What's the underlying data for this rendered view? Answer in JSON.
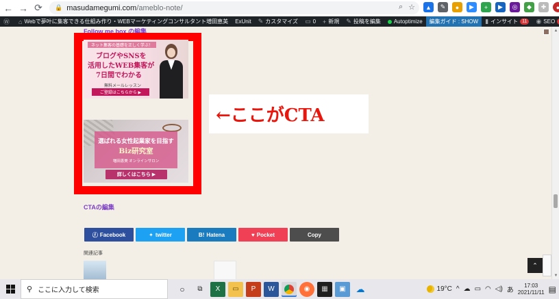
{
  "browser": {
    "url_host": "masudamegumi.com",
    "url_path": "/ameblo-note/"
  },
  "adminbar": {
    "site_name": "Webで夢叶に集客できる仕組み作り・WEBマーケティングコンサルタント増田恵美",
    "exunit": "ExUnit",
    "customize": "カスタマイズ",
    "comments": "0",
    "new": "新規",
    "edit_post": "投稿を編集",
    "autoptimize": "Autoptimize",
    "edit_guide": "編集ガイド : SHOW",
    "insight": "インサイト",
    "insight_badge": "11",
    "seo": "SEO",
    "seo_badge": "4"
  },
  "content": {
    "follow_link": "Follow me box の編集",
    "banner1": {
      "ribbon": "ネット集客の基礎を正しく学ぶ！",
      "line1": "ブログやSNSを",
      "line2": "活用したWEB集客が",
      "line3": "7日間でわかる",
      "sub": "無料メールレッスン",
      "button": "ご登録はこちらから ▶"
    },
    "banner2": {
      "line1": "選ばれる女性起業家を目指す",
      "line2": "Biz研究室",
      "line3": "増田恵美 オンラインサロン",
      "button": "詳しくはこちら ▶"
    },
    "annotation": "←ここがCTA",
    "cta_edit": "CTAの編集",
    "share": {
      "facebook": "Facebook",
      "twitter": "twitter",
      "hatena": "Hatena",
      "pocket": "Pocket",
      "copy": "Copy"
    },
    "related_title": "関連記事"
  },
  "taskbar": {
    "search_placeholder": "ここに入力して検索",
    "temperature": "19°C",
    "ime": "あ",
    "time": "17:03",
    "date": "2021/11/11"
  },
  "colors": {
    "cta_border": "#ff0000",
    "annotation_text": "#e8160c",
    "link_purple": "#7b3dc4",
    "facebook": "#2e4f9e",
    "twitter": "#1da1f2",
    "hatena": "#1b7bbf",
    "pocket": "#ef4056",
    "copy": "#4d4d4d"
  }
}
